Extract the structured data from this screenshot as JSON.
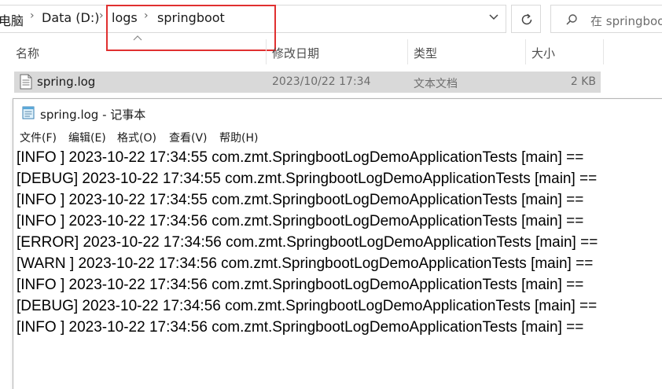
{
  "explorer": {
    "breadcrumb": [
      {
        "label": "电脑"
      },
      {
        "label": "Data (D:)"
      },
      {
        "label": "logs"
      },
      {
        "label": "springboot"
      }
    ],
    "search_placeholder": "在 springboot",
    "columns": {
      "name": "名称",
      "modified": "修改日期",
      "type": "类型",
      "size": "大小"
    },
    "files": [
      {
        "name": "spring.log",
        "modified": "2023/10/22 17:34",
        "type": "文本文档",
        "size": "2 KB"
      }
    ],
    "highlight_color": "#e03030"
  },
  "notepad": {
    "title": "spring.log - 记事本",
    "menu": {
      "file": "文件(F)",
      "edit": "编辑(E)",
      "format": "格式(O)",
      "view": "查看(V)",
      "help": "帮助(H)"
    },
    "lines": [
      "[INFO ] 2023-10-22 17:34:55 com.zmt.SpringbootLogDemoApplicationTests [main] ==",
      "[DEBUG] 2023-10-22 17:34:55 com.zmt.SpringbootLogDemoApplicationTests [main] ==",
      "[INFO ] 2023-10-22 17:34:55 com.zmt.SpringbootLogDemoApplicationTests [main] ==",
      "[INFO ] 2023-10-22 17:34:56 com.zmt.SpringbootLogDemoApplicationTests [main] ==",
      "[ERROR] 2023-10-22 17:34:56 com.zmt.SpringbootLogDemoApplicationTests [main] ==",
      "[WARN ] 2023-10-22 17:34:56 com.zmt.SpringbootLogDemoApplicationTests [main] ==",
      "[INFO ] 2023-10-22 17:34:56 com.zmt.SpringbootLogDemoApplicationTests [main] ==",
      "[DEBUG] 2023-10-22 17:34:56 com.zmt.SpringbootLogDemoApplicationTests [main] ==",
      "[INFO ] 2023-10-22 17:34:56 com.zmt.SpringbootLogDemoApplicationTests [main] =="
    ]
  }
}
